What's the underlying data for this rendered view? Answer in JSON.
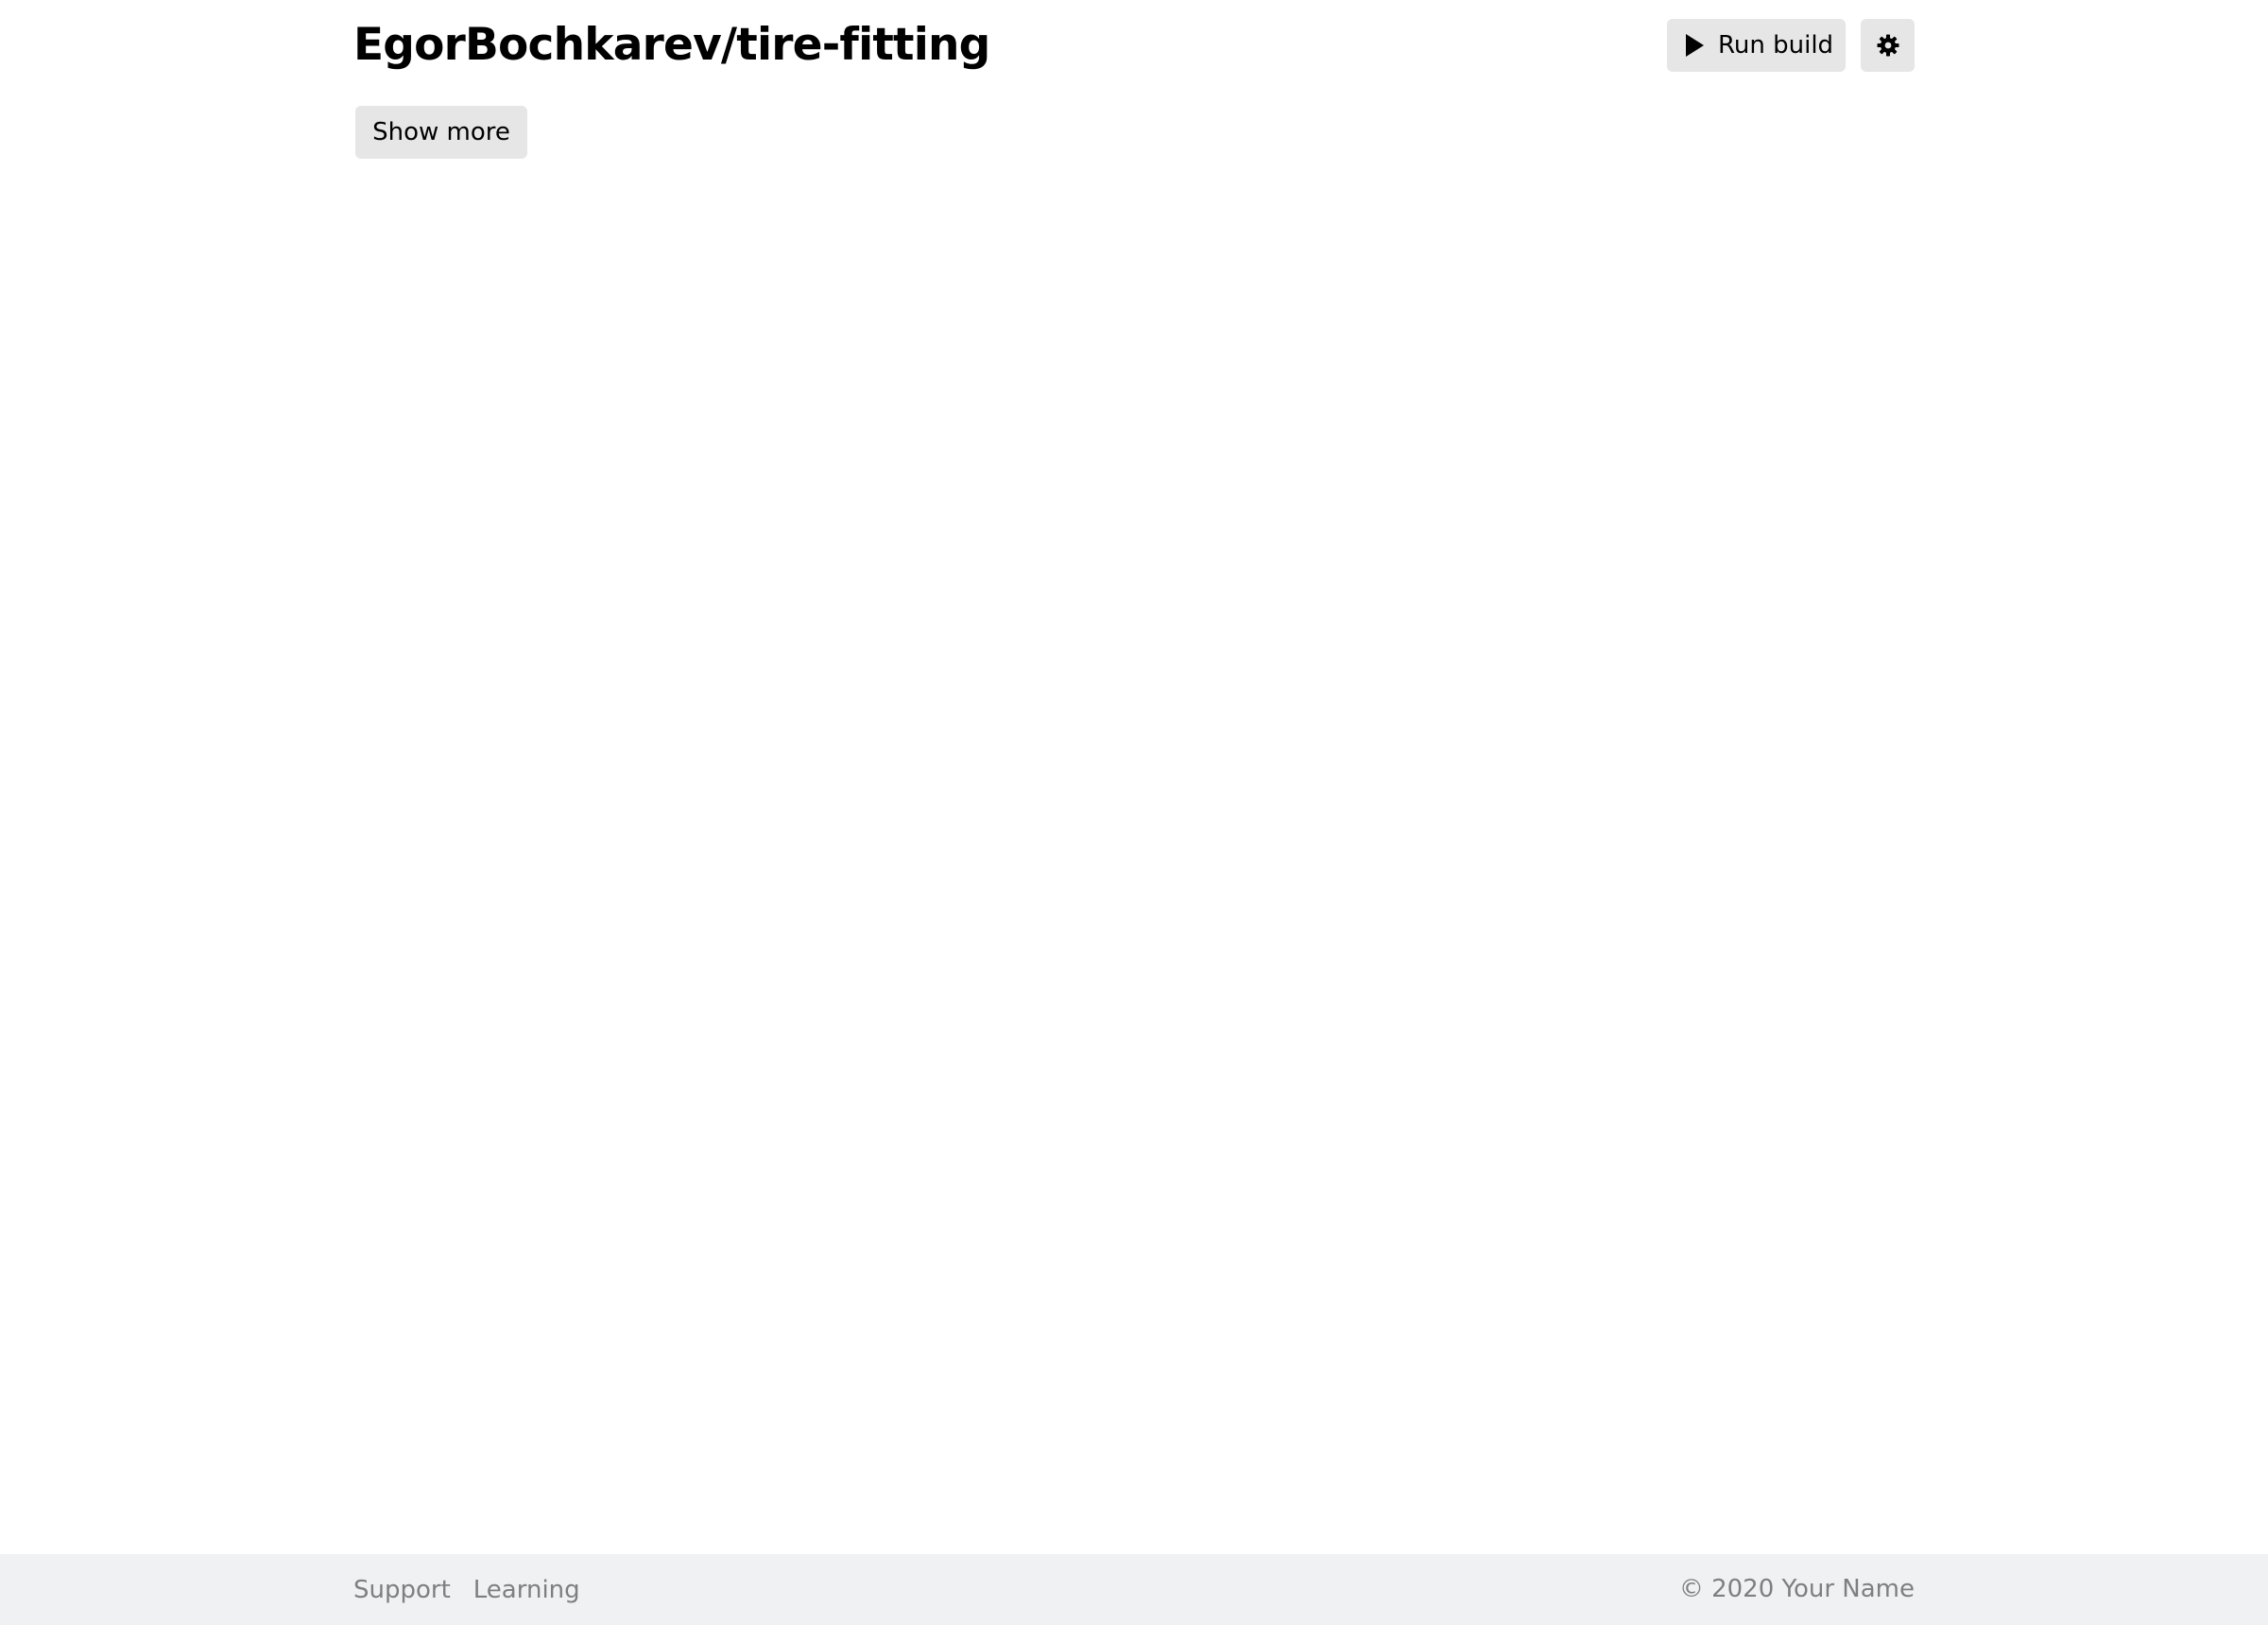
{
  "header": {
    "title": "EgorBochkarev/tire-fitting",
    "run_build_label": "Run build",
    "run_build_icon": "play-icon",
    "settings_icon": "gear-icon"
  },
  "main": {
    "show_more_label": "Show more"
  },
  "footer": {
    "links": [
      {
        "label": "Support"
      },
      {
        "label": "Learning"
      }
    ],
    "copyright": "© 2020 Your Name"
  },
  "colors": {
    "button_bg": "#e6e6e6",
    "footer_bg": "#f0f1f3",
    "footer_text": "#7f7f7f"
  }
}
